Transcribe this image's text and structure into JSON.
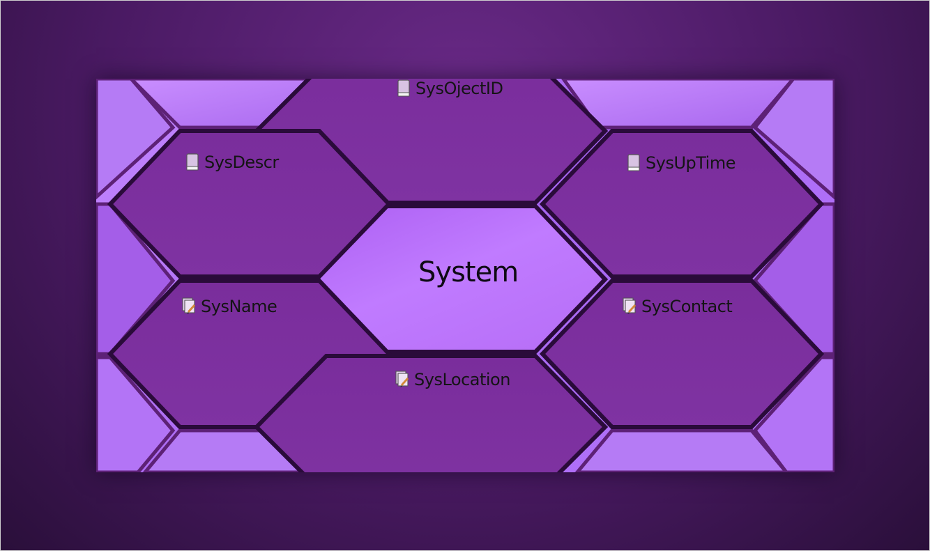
{
  "diagram": {
    "center_title": "System",
    "nodes": [
      {
        "id": "sysobjectid",
        "label": "SysOjectID",
        "icon": "book-icon"
      },
      {
        "id": "sysdescr",
        "label": "SysDescr",
        "icon": "book-icon"
      },
      {
        "id": "sysuptime",
        "label": "SysUpTime",
        "icon": "book-icon"
      },
      {
        "id": "sysname",
        "label": "SysName",
        "icon": "edit-document-icon"
      },
      {
        "id": "syscontact",
        "label": "SysContact",
        "icon": "edit-document-icon"
      },
      {
        "id": "syslocation",
        "label": "SysLocation",
        "icon": "edit-document-icon"
      }
    ]
  },
  "colors": {
    "background": "#4a1a63",
    "panel": "#b778ff",
    "hex_dark": "#7b2f9e",
    "hex_center": "#b66af5",
    "text": "#141414"
  }
}
